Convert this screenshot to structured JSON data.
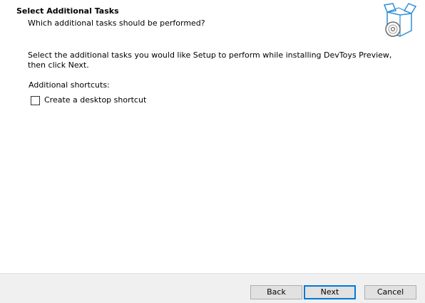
{
  "header": {
    "title": "Select Additional Tasks",
    "subtitle": "Which additional tasks should be performed?",
    "icon": "setup-box-disc-icon"
  },
  "content": {
    "intro": "Select the additional tasks you would like Setup to perform while installing DevToys Preview, then click Next.",
    "group_label": "Additional shortcuts:",
    "tasks": [
      {
        "label": "Create a desktop shortcut",
        "checked": false
      }
    ]
  },
  "footer": {
    "back_label": "Back",
    "next_label": "Next",
    "cancel_label": "Cancel"
  },
  "colors": {
    "accent": "#0078d7",
    "footer_bg": "#f0f0f0",
    "button_bg": "#e1e1e1",
    "icon_blue": "#2e8fd8"
  }
}
